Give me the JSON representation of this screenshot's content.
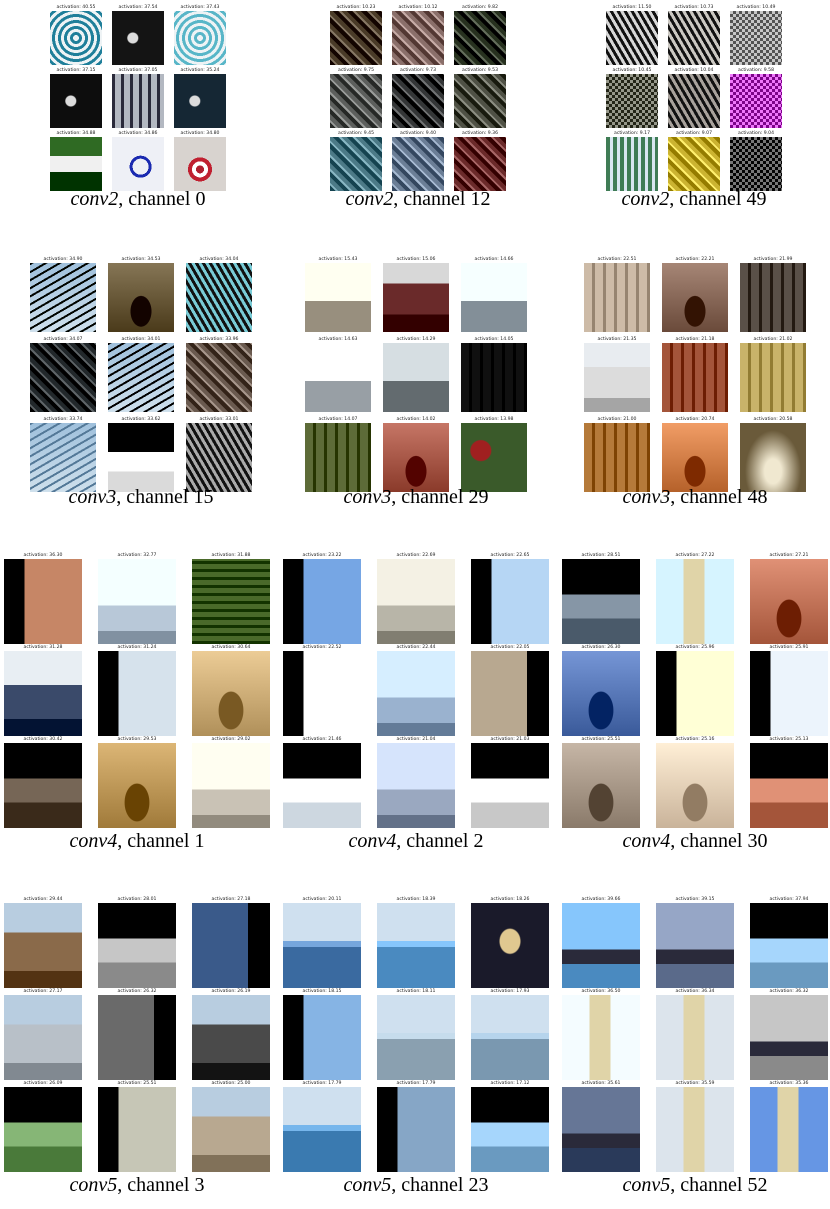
{
  "figure": {
    "panels": [
      {
        "layer": "conv2",
        "sep": ", ",
        "channel": "channel 0",
        "activations": [
          "activation: 40.55",
          "activation: 37.54",
          "activation: 37.43",
          "activation: 37.15",
          "activation: 37.05",
          "activation: 35.24",
          "activation: 34.88",
          "activation: 34.86",
          "activation: 34.80"
        ],
        "palette": [
          "#1f7f9a",
          "#141414",
          "#58b6c8",
          "#0d0d0d",
          "#b3b8c1",
          "#152734",
          "#2f6a23",
          "#eef0f6",
          "#d8d3cf"
        ],
        "textures": [
          "spiral",
          "dark-letters",
          "spiral",
          "dark-letters",
          "letters-light",
          "dark-letters",
          "letters-green",
          "letters-blue",
          "target"
        ]
      },
      {
        "layer": "conv2",
        "sep": ", ",
        "channel": "channel 12",
        "activations": [
          "activation: 10.23",
          "activation: 10.12",
          "activation: 9.82",
          "activation: 9.75",
          "activation: 9.73",
          "activation: 9.53",
          "activation: 9.45",
          "activation: 9.40",
          "activation: 9.36"
        ],
        "palette": [
          "#4a3b28",
          "#8a6f6a",
          "#27311f",
          "#5d5f5d",
          "#343637",
          "#4f5145",
          "#4c7a87",
          "#6b7e96",
          "#6b2a2a"
        ],
        "textures": [
          "diag",
          "diag",
          "diag",
          "diag",
          "diag",
          "diag",
          "diag",
          "diag",
          "diag"
        ]
      },
      {
        "layer": "conv2",
        "sep": ", ",
        "channel": "channel 49",
        "activations": [
          "activation: 11.50",
          "activation: 10.73",
          "activation: 10.49",
          "activation: 10.45",
          "activation: 10.04",
          "activation: 9.58",
          "activation: 9.17",
          "activation: 9.07",
          "activation: 9.04"
        ],
        "palette": [
          "#9b9b9b",
          "#8f8c86",
          "#8a8a8a",
          "#5a5c4e",
          "#6c6660",
          "#b33bbf",
          "#3f7c55",
          "#cbb331",
          "#3a3a3a"
        ],
        "textures": [
          "stripes",
          "stripes",
          "check",
          "check",
          "stripes",
          "check",
          "vstripes",
          "diag",
          "check"
        ]
      },
      {
        "layer": "conv3",
        "sep": ", ",
        "channel": "channel 15",
        "activations": [
          "activation: 34.90",
          "activation: 34.53",
          "activation: 34.04",
          "activation: 34.07",
          "activation: 34.01",
          "activation: 33.96",
          "activation: 33.74",
          "activation: 33.62",
          "activation: 33.01"
        ],
        "palette": [
          "#2c3b2a",
          "#4a3a1a",
          "#3d8f9a",
          "#22282b",
          "#1b2a1b",
          "#6a5a4f",
          "#8bb0cf",
          "#dadada",
          "#6e6e6e"
        ],
        "textures": [
          "palm",
          "arch",
          "stripes",
          "diag",
          "palm",
          "diag",
          "palm",
          "black-top",
          "stripes"
        ]
      },
      {
        "layer": "conv3",
        "sep": ", ",
        "channel": "channel 29",
        "activations": [
          "activation: 15.43",
          "activation: 15.06",
          "activation: 14.66",
          "activation: 14.63",
          "activation: 14.29",
          "activation: 14.05",
          "activation: 14.07",
          "activation: 14.02",
          "activation: 13.98"
        ],
        "palette": [
          "#cfc6b5",
          "#6a2a2a",
          "#bac6cf",
          "#cfd6dc",
          "#9aa2a6",
          "#101010",
          "#5d6b38",
          "#8a3a2a",
          "#3a5a2a"
        ],
        "textures": [
          "spires",
          "houses",
          "spires",
          "spires",
          "spires",
          "windows",
          "windows",
          "arch",
          "red"
        ]
      },
      {
        "layer": "conv3",
        "sep": ", ",
        "channel": "channel 48",
        "activations": [
          "activation: 22.51",
          "activation: 22.21",
          "activation: 21.99",
          "activation: 21.35",
          "activation: 21.18",
          "activation: 21.02",
          "activation: 21.00",
          "activation: 20.74",
          "activation: 20.58"
        ],
        "palette": [
          "#cdbba7",
          "#6a4a3a",
          "#5a5048",
          "#dcdcdc",
          "#a4553a",
          "#c9b36a",
          "#b57a3a",
          "#b5612a",
          "#6a5a3a"
        ],
        "textures": [
          "windows",
          "arch",
          "windows",
          "house",
          "windows",
          "windows",
          "windows",
          "arch",
          "fountain"
        ]
      },
      {
        "layer": "conv4",
        "sep": ", ",
        "channel": "channel 1",
        "activations": [
          "activation: 36.30",
          "activation: 32.77",
          "activation: 31.88",
          "activation: 31.28",
          "activation: 31.24",
          "activation: 30.64",
          "activation: 30.42",
          "activation: 29.53",
          "activation: 29.02"
        ],
        "palette": [
          "#8a4a2a",
          "#b8c8d8",
          "#4a6a2a",
          "#3a4a6a",
          "#9aa6b0",
          "#b0905a",
          "#3a2a1a",
          "#a07a3a",
          "#c9c2b5"
        ],
        "textures": [
          "black-left",
          "dome",
          "roof",
          "people",
          "black-left",
          "arch",
          "black-top",
          "arch",
          "dome"
        ]
      },
      {
        "layer": "conv4",
        "sep": ", ",
        "channel": "channel 2",
        "activations": [
          "activation: 23.22",
          "activation: 22.69",
          "activation: 22.65",
          "activation: 22.52",
          "activation: 22.44",
          "activation: 22.05",
          "activation: 21.46",
          "activation: 21.04",
          "activation: 21.03"
        ],
        "palette": [
          "#3a6aa8",
          "#b8b5a8",
          "#7a9ab8",
          "#dcdcd0",
          "#9ab2cf",
          "#b8a890",
          "#cdd7e0",
          "#9aa8c0",
          "#c8c8c8"
        ],
        "textures": [
          "black-left",
          "dome",
          "black-left",
          "black-left",
          "dome",
          "black-right",
          "black-top",
          "dome",
          "black-top"
        ]
      },
      {
        "layer": "conv4",
        "sep": ", ",
        "channel": "channel 30",
        "activations": [
          "activation: 28.51",
          "activation: 27.22",
          "activation: 27.21",
          "activation: 26.30",
          "activation: 25.96",
          "activation: 25.91",
          "activation: 25.51",
          "activation: 25.16",
          "activation: 25.13"
        ],
        "palette": [
          "#4a5a6a",
          "#9ab8cf",
          "#a4553a",
          "#3a5a9a",
          "#d8c89a",
          "#b0b8c0",
          "#8a7a6a",
          "#c9b39a",
          "#a4553a"
        ],
        "textures": [
          "black-top",
          "tower",
          "arch",
          "arch",
          "black-left",
          "black-left",
          "arch",
          "arch",
          "black-top"
        ]
      },
      {
        "layer": "conv5",
        "sep": ", ",
        "channel": "channel 3",
        "activations": [
          "activation: 29.44",
          "activation: 28.01",
          "activation: 27.18",
          "activation: 27.17",
          "activation: 26.32",
          "activation: 26.19",
          "activation: 26.09",
          "activation: 25.51",
          "activation: 25.00"
        ],
        "palette": [
          "#8a6a4a",
          "#8a8a8a",
          "#3a5a8a",
          "#b8c0c8",
          "#6a6a6a",
          "#4a4a4a",
          "#4a7a3a",
          "#8a8a7a",
          "#b8a890"
        ],
        "textures": [
          "city",
          "black-top",
          "black-right",
          "city",
          "black-right",
          "city",
          "black-top",
          "black-left",
          "city"
        ]
      },
      {
        "layer": "conv5",
        "sep": ", ",
        "channel": "channel 23",
        "activations": [
          "activation: 20.11",
          "activation: 18.39",
          "activation: 18.26",
          "activation: 18.15",
          "activation: 18.11",
          "activation: 17.93",
          "activation: 17.79",
          "activation: 17.79",
          "activation: 17.12"
        ],
        "palette": [
          "#3a6aa0",
          "#4a8ac0",
          "#1a1a2a",
          "#4a78a8",
          "#8aa0b0",
          "#7a98b0",
          "#3a7ab0",
          "#4a6a8a",
          "#6a9ac0"
        ],
        "textures": [
          "sea",
          "sea",
          "castle",
          "black-left",
          "sea",
          "sea",
          "sea",
          "black-left",
          "black-top"
        ]
      },
      {
        "layer": "conv5",
        "sep": ", ",
        "channel": "channel 52",
        "activations": [
          "activation: 39.66",
          "activation: 39.15",
          "activation: 37.94",
          "activation: 36.50",
          "activation: 36.34",
          "activation: 36.32",
          "activation: 35.61",
          "activation: 35.59",
          "activation: 35.36"
        ],
        "palette": [
          "#4a8ac0",
          "#5a6a8a",
          "#6a9ac0",
          "#b8c0c8",
          "#a0a8b0",
          "#8a8a8a",
          "#2a3a5a",
          "#a0a8b0",
          "#2a5aa8"
        ],
        "textures": [
          "skyline",
          "skyline",
          "black-top",
          "tower",
          "tower",
          "skyline",
          "skyline",
          "tower",
          "tower"
        ]
      }
    ]
  }
}
